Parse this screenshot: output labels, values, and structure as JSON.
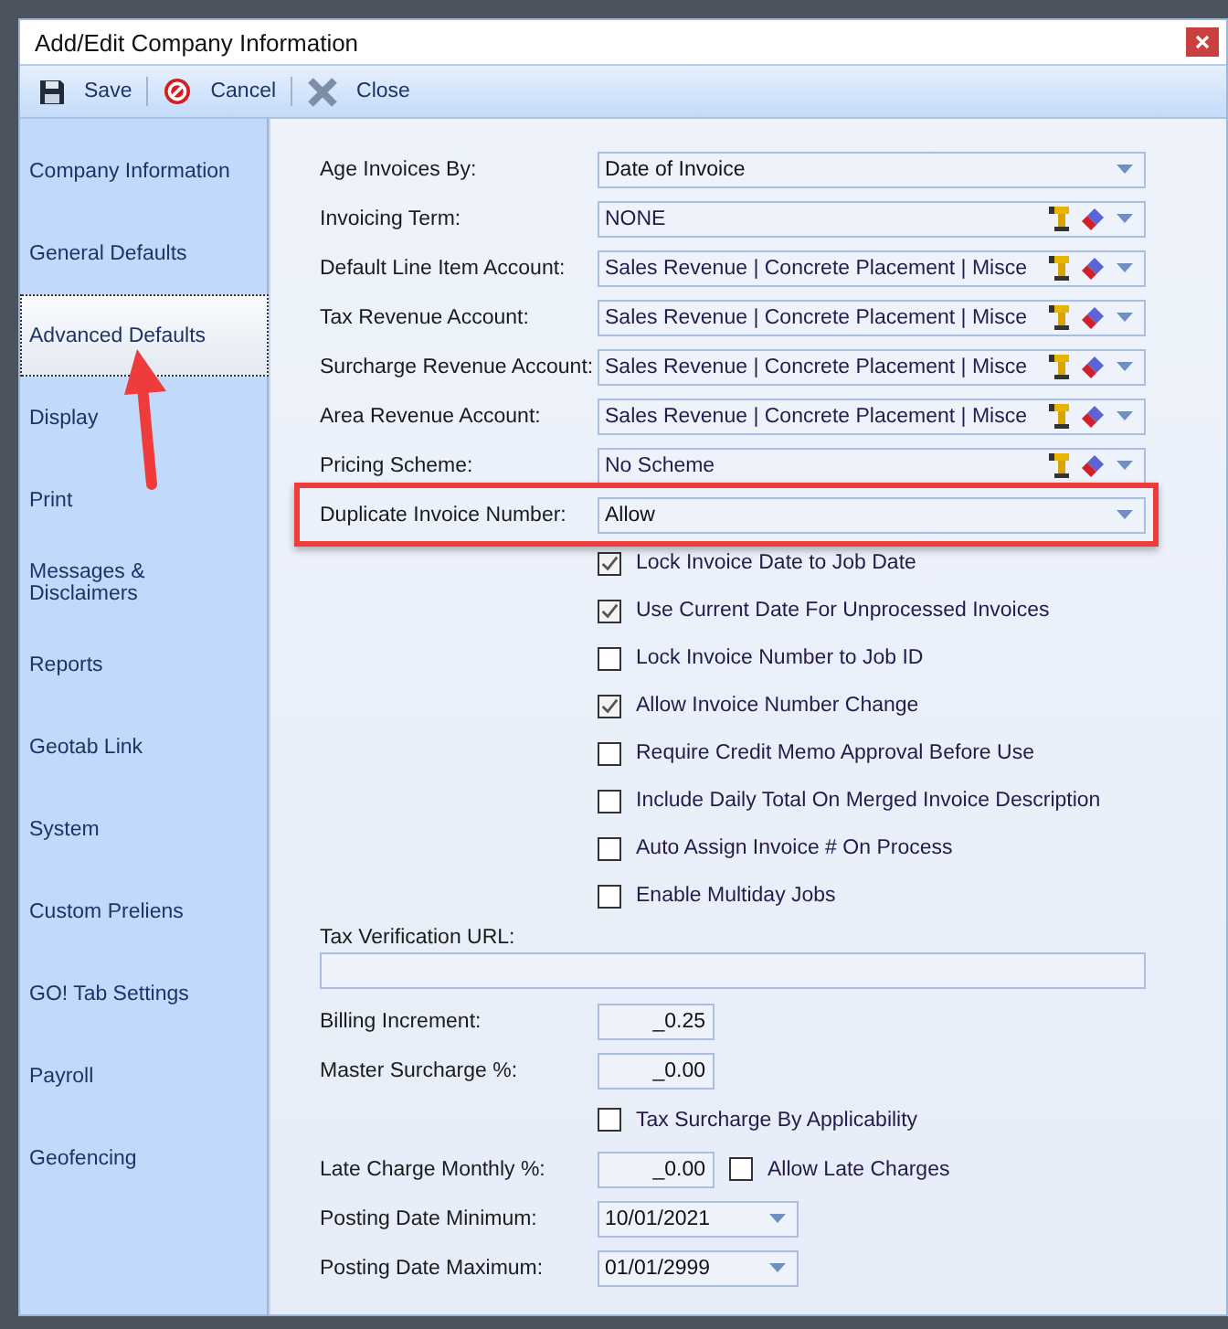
{
  "window": {
    "title": "Add/Edit Company Information"
  },
  "toolbar": [
    {
      "label": "Save",
      "kind": "save"
    },
    {
      "label": "Cancel",
      "kind": "cancel"
    },
    {
      "label": "Close",
      "kind": "close"
    }
  ],
  "sidebar": {
    "items": [
      {
        "label": "Company Information",
        "selected": false
      },
      {
        "label": "General Defaults",
        "selected": false
      },
      {
        "label": "Advanced Defaults",
        "selected": true
      },
      {
        "label": "Display",
        "selected": false
      },
      {
        "label": "Print",
        "selected": false
      },
      {
        "label": "Messages & Disclaimers",
        "selected": false
      },
      {
        "label": "Reports",
        "selected": false
      },
      {
        "label": "Geotab Link",
        "selected": false
      },
      {
        "label": "System",
        "selected": false
      },
      {
        "label": "Custom Preliens",
        "selected": false
      },
      {
        "label": "GO! Tab Settings",
        "selected": false
      },
      {
        "label": "Payroll",
        "selected": false
      },
      {
        "label": "Geofencing",
        "selected": false
      }
    ]
  },
  "fields": [
    {
      "label": "Age Invoices By:",
      "value": "Date of Invoice",
      "kind": "dropdown"
    },
    {
      "label": "Invoicing Term:",
      "value": "NONE",
      "kind": "lookup"
    },
    {
      "label": "Default Line Item Account:",
      "value": "Sales Revenue |  Concrete Placement |  Misce",
      "kind": "lookup"
    },
    {
      "label": "Tax Revenue Account:",
      "value": "Sales Revenue |  Concrete Placement |  Misce",
      "kind": "lookup"
    },
    {
      "label": "Surcharge Revenue Account:",
      "value": "Sales Revenue |  Concrete Placement |  Misce",
      "kind": "lookup"
    },
    {
      "label": "Area Revenue Account:",
      "value": "Sales Revenue |  Concrete Placement |  Misce",
      "kind": "lookup"
    },
    {
      "label": "Pricing Scheme:",
      "value": "No Scheme",
      "kind": "lookup"
    },
    {
      "label": "Duplicate Invoice Number:",
      "value": "Allow",
      "kind": "dropdown"
    }
  ],
  "checkboxes": [
    {
      "label": "Lock Invoice Date to Job Date",
      "checked": true
    },
    {
      "label": "Use Current Date For Unprocessed Invoices",
      "checked": true
    },
    {
      "label": "Lock Invoice Number to Job ID",
      "checked": false
    },
    {
      "label": "Allow Invoice Number Change",
      "checked": true
    },
    {
      "label": "Require Credit Memo Approval Before Use",
      "checked": false
    },
    {
      "label": "Include Daily Total On Merged Invoice Description",
      "checked": false
    },
    {
      "label": "Auto Assign Invoice # On Process",
      "checked": false
    },
    {
      "label": "Enable Multiday Jobs",
      "checked": false
    }
  ],
  "tax_verification_url": {
    "label": "Tax Verification URL:"
  },
  "lower_rows": [
    {
      "kind": "number",
      "label": "Billing Increment:",
      "value": "_0.25"
    },
    {
      "kind": "number",
      "label": "Master Surcharge %:",
      "value": "_0.00"
    },
    {
      "kind": "checkbox",
      "check_label": "Tax Surcharge By Applicability",
      "checked": false
    },
    {
      "kind": "number",
      "label": "Late Charge Monthly %:",
      "value": "_0.00",
      "check_label": "Allow Late Charges",
      "checked": false
    },
    {
      "kind": "date",
      "label": "Posting Date Minimum:",
      "value": "10/01/2021"
    },
    {
      "kind": "date",
      "label": "Posting Date Maximum:",
      "value": "01/01/2999"
    }
  ]
}
